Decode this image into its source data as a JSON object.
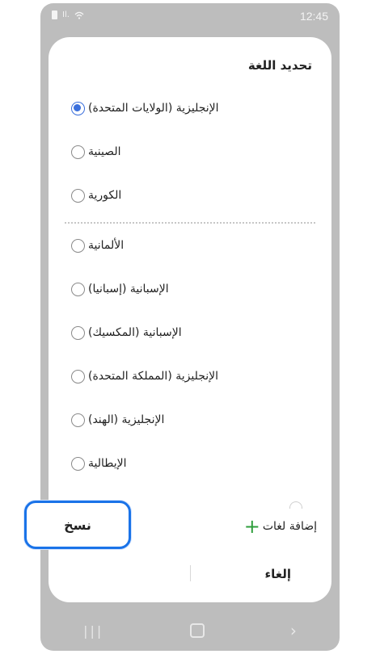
{
  "status_bar": {
    "time": "12:45",
    "signal": "Il."
  },
  "sheet": {
    "title": "تحديد اللغة",
    "languages": [
      {
        "label": "الإنجليزية (الولايات المتحدة)",
        "selected": true
      },
      {
        "label": "الصينية",
        "selected": false
      },
      {
        "label": "الكورية",
        "selected": false
      },
      {
        "label": "الألمانية",
        "selected": false
      },
      {
        "label": "الإسبانية (إسبانيا)",
        "selected": false
      },
      {
        "label": "الإسبانية (المكسيك)",
        "selected": false
      },
      {
        "label": "الإنجليزية (المملكة المتحدة)",
        "selected": false
      },
      {
        "label": "الإنجليزية (الهند)",
        "selected": false
      },
      {
        "label": "الإيطالية",
        "selected": false
      }
    ],
    "add_languages_label": "إضافة لغات",
    "cancel_label": "إلغاء",
    "copy_label": "نسخ"
  },
  "colors": {
    "accent": "#3a6fdc",
    "highlight": "#1a73e8",
    "add_icon": "#2e9e3c"
  }
}
